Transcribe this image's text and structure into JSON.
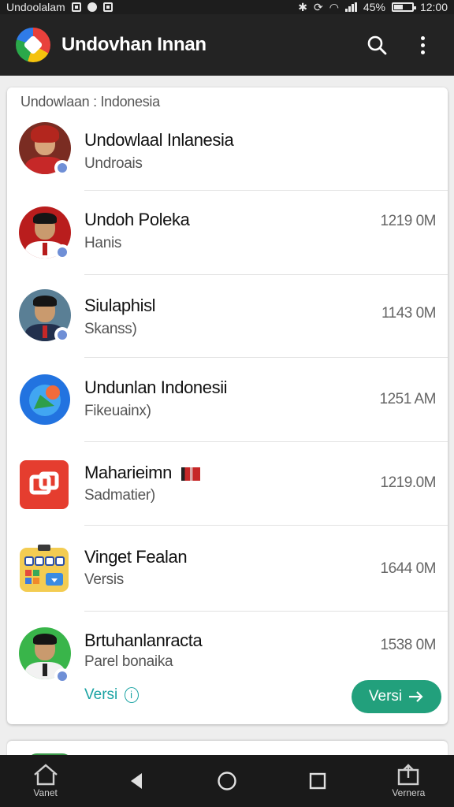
{
  "status_bar": {
    "left_text": "Undoolalam",
    "battery_percent": "45%",
    "time": "12:00"
  },
  "app_bar": {
    "title": "Undovhan Innan",
    "icons": [
      "app-logo",
      "search-icon",
      "more-vert-icon"
    ]
  },
  "card": {
    "header": "Undowlaan : Indonesia",
    "items": [
      {
        "title": "Undowlaal Inlanesia",
        "subtitle": "Undroais",
        "size": "",
        "icon": "avatar-woman-hijab"
      },
      {
        "title": "Undoh Poleka",
        "subtitle": "Hanis",
        "size": "1219 0M",
        "icon": "avatar-man-peci"
      },
      {
        "title": "Siulaphisl",
        "subtitle": "Skanss)",
        "size": "1143 0M",
        "icon": "avatar-man-peci"
      },
      {
        "title": "Undunlan Indonesii",
        "subtitle": "Fikeuainx)",
        "size": "1251 AM",
        "icon": "chat-app-icon"
      },
      {
        "title": "Maharieimn",
        "subtitle": "Sadmatier)",
        "size": "1219.0M",
        "icon": "red-square-app-icon"
      },
      {
        "title": "Vinget Fealan",
        "subtitle": "Versis",
        "size": "1644 0M",
        "icon": "widget-grid-app-icon"
      },
      {
        "title": "Brtuhanlanracta",
        "subtitle": "Parel bonaika",
        "size": "1538 0M",
        "icon": "avatar-man-peci"
      }
    ],
    "versi_link": "Versi",
    "versi_button": "Versi"
  },
  "bottom_nav": {
    "home_label": "Vanet",
    "right_label": "Vernera"
  },
  "colors": {
    "app_bar": "#232323",
    "accent_green": "#22a07c",
    "link_teal": "#1aa3a3"
  }
}
